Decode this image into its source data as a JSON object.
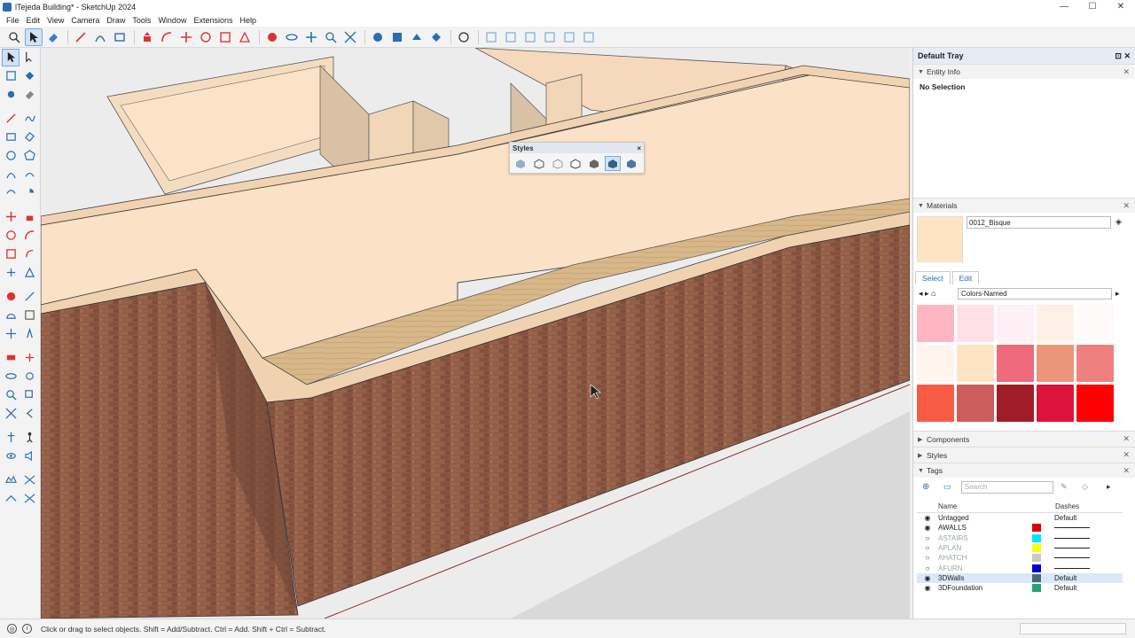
{
  "window": {
    "title": "lTejeda Building* - SketchUp 2024",
    "minimize": "—",
    "maximize": "☐",
    "close": "✕"
  },
  "menu": [
    "File",
    "Edit",
    "View",
    "Camera",
    "Draw",
    "Tools",
    "Window",
    "Extensions",
    "Help"
  ],
  "styles_toolbar": {
    "title": "Styles",
    "close": "×"
  },
  "tray": {
    "title": "Default Tray",
    "entity_info": {
      "label": "Entity Info",
      "body": "No Selection"
    },
    "materials": {
      "label": "Materials",
      "current_name": "0012_Bisque",
      "current_color": "#ffe4c4",
      "tabs": [
        "Select",
        "Edit"
      ],
      "library": "Colors-Named",
      "swatches": [
        "#ffb6c1",
        "#ffe0e6",
        "#fff0f5",
        "#ffefe5",
        "#fffafa",
        "#fff5ee",
        "#ffe4c4",
        "#ee6a7c",
        "#e9967a",
        "#f08080",
        "#f85b44",
        "#cd5c5c",
        "#a01d28",
        "#dc143c",
        "#ff0000"
      ]
    },
    "components": {
      "label": "Components"
    },
    "styles": {
      "label": "Styles"
    },
    "tags": {
      "label": "Tags",
      "search_placeholder": "Search",
      "col_name": "Name",
      "col_dashes": "Dashes",
      "rows": [
        {
          "name": "Untagged",
          "visible": true,
          "color": "",
          "dash": "Default"
        },
        {
          "name": "AWALLS",
          "visible": true,
          "color": "#e00000",
          "dash": ""
        },
        {
          "name": "ASTAIRS",
          "visible": false,
          "color": "#00e5ff",
          "dash": ""
        },
        {
          "name": "APLAN",
          "visible": false,
          "color": "#ffff00",
          "dash": ""
        },
        {
          "name": "AHATCH",
          "visible": false,
          "color": "#c8c8c8",
          "dash": ""
        },
        {
          "name": "AFURN",
          "visible": false,
          "color": "#0000d0",
          "dash": ""
        },
        {
          "name": "3DWalls",
          "visible": true,
          "color": "#4a6a78",
          "dash": "Default"
        },
        {
          "name": "3DFoundation",
          "visible": true,
          "color": "#2aa07a",
          "dash": "Default"
        }
      ]
    }
  },
  "status": {
    "hint": "Click or drag to select objects. Shift = Add/Subtract. Ctrl = Add. Shift + Ctrl = Subtract."
  }
}
